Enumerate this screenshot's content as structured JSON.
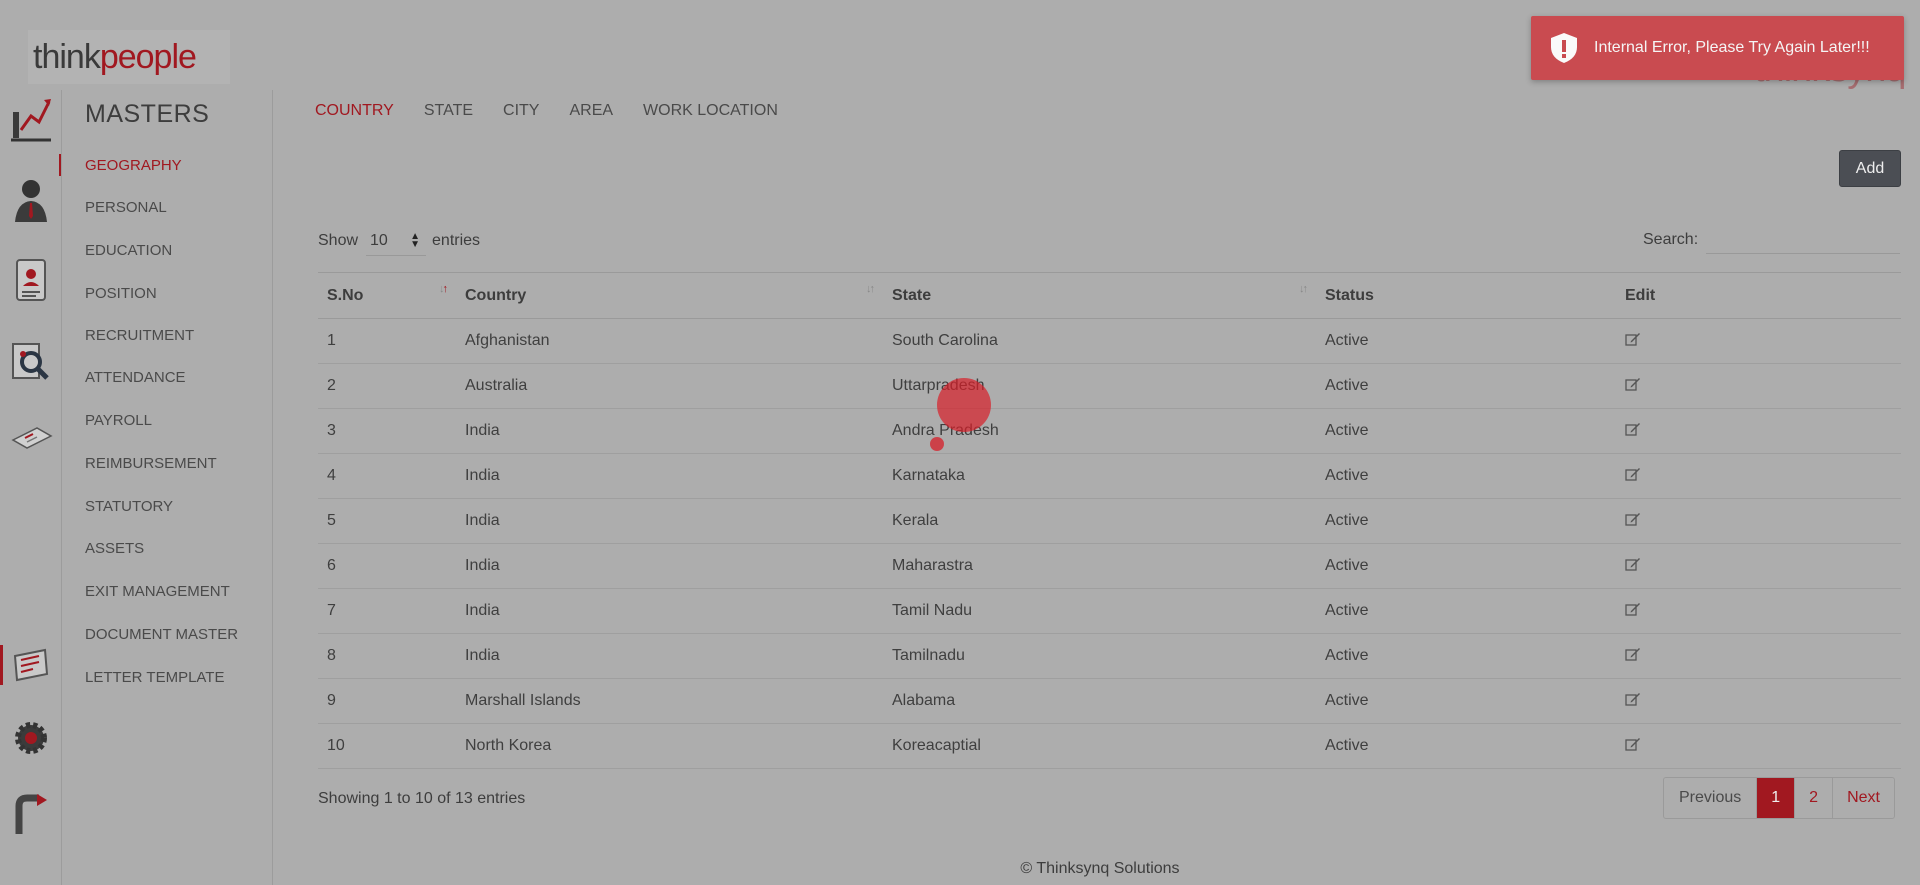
{
  "logo": {
    "part1": "think",
    "part2": "people"
  },
  "brand_watermark": "thinksynq",
  "toast": {
    "message": "Internal Error, Please Try Again Later!!!"
  },
  "rail_icons": [
    "growth-chart-icon",
    "employee-icon",
    "document-profile-icon",
    "search-person-icon",
    "laptop-icon",
    "checklist-icon",
    "settings-gear-icon",
    "logout-icon"
  ],
  "masters": {
    "title": "MASTERS",
    "items": [
      {
        "label": "GEOGRAPHY",
        "active": true
      },
      {
        "label": "PERSONAL"
      },
      {
        "label": "EDUCATION"
      },
      {
        "label": "POSITION"
      },
      {
        "label": "RECRUITMENT"
      },
      {
        "label": "ATTENDANCE"
      },
      {
        "label": "PAYROLL"
      },
      {
        "label": "REIMBURSEMENT"
      },
      {
        "label": "STATUTORY"
      },
      {
        "label": "ASSETS"
      },
      {
        "label": "EXIT MANAGEMENT"
      },
      {
        "label": "DOCUMENT MASTER"
      },
      {
        "label": "LETTER TEMPLATE"
      }
    ]
  },
  "tabs": [
    {
      "label": "COUNTRY",
      "active": true
    },
    {
      "label": "STATE"
    },
    {
      "label": "CITY"
    },
    {
      "label": "AREA"
    },
    {
      "label": "WORK LOCATION"
    }
  ],
  "add_button": "Add",
  "length": {
    "prefix": "Show",
    "value": "10",
    "suffix": "entries"
  },
  "search": {
    "label": "Search:",
    "value": ""
  },
  "table": {
    "columns": [
      "S.No",
      "Country",
      "State",
      "Status",
      "Edit"
    ],
    "rows": [
      [
        "1",
        "Afghanistan",
        "South Carolina",
        "Active"
      ],
      [
        "2",
        "Australia",
        "Uttarpradesh",
        "Active"
      ],
      [
        "3",
        "India",
        "Andra Pradesh",
        "Active"
      ],
      [
        "4",
        "India",
        "Karnataka",
        "Active"
      ],
      [
        "5",
        "India",
        "Kerala",
        "Active"
      ],
      [
        "6",
        "India",
        "Maharastra",
        "Active"
      ],
      [
        "7",
        "India",
        "Tamil Nadu",
        "Active"
      ],
      [
        "8",
        "India",
        "Tamilnadu",
        "Active"
      ],
      [
        "9",
        "Marshall Islands",
        "Alabama",
        "Active"
      ],
      [
        "10",
        "North Korea",
        "Koreacaptial",
        "Active"
      ]
    ]
  },
  "info": "Showing 1 to 10 of 13 entries",
  "pagination": {
    "previous": "Previous",
    "pages": [
      "1",
      "2"
    ],
    "current": "1",
    "next": "Next"
  },
  "footer": "© Thinksynq Solutions",
  "colors": {
    "accent": "#a11820",
    "toast": "#c94b50",
    "add_button": "#4b4e54"
  }
}
